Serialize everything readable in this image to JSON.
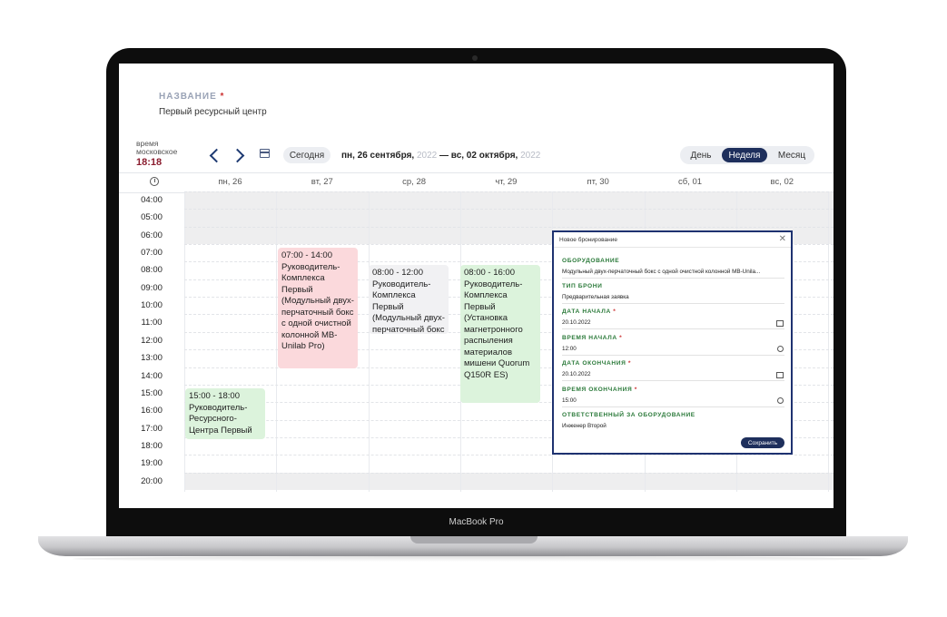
{
  "device": {
    "brand": "MacBook Pro"
  },
  "header": {
    "name_label": "НАЗВАНИЕ",
    "required_mark": "*",
    "name_value": "Первый ресурсный центр",
    "timezone_label": "время московское",
    "current_time": "18:18"
  },
  "toolbar": {
    "prev_icon": "chevron-left-icon",
    "next_icon": "chevron-right-icon",
    "calendar_icon": "calendar-icon",
    "today_label": "Сегодня",
    "range_start": "пн, 26 сентября",
    "range_start_year": "2022",
    "range_sep": "— вс, 02 октября",
    "range_end_year": "2022",
    "views": [
      "День",
      "Неделя",
      "Месяц"
    ],
    "active_view": "Неделя"
  },
  "days": [
    "пн, 26",
    "вт, 27",
    "ср, 28",
    "чт, 29",
    "пт, 30",
    "сб, 01",
    "вс, 02"
  ],
  "hours": [
    "04:00",
    "05:00",
    "06:00",
    "07:00",
    "08:00",
    "09:00",
    "10:00",
    "11:00",
    "12:00",
    "13:00",
    "14:00",
    "15:00",
    "16:00",
    "17:00",
    "18:00",
    "19:00",
    "20:00"
  ],
  "events": [
    {
      "day": "вт, 27",
      "time": "07:00 - 14:00",
      "title": "Руководитель-Комплекса Первый",
      "detail": "(Модульный двух-перчаточный бокс с одной очистной колонной MB-Unilab Pro)",
      "color": "#fbd9dc"
    },
    {
      "day": "ср, 28",
      "time": "08:00 - 12:00",
      "title": "Руководитель-Комплекса Первый",
      "detail": "(Модульный двух-перчаточный бокс",
      "color": "#f1f1f3"
    },
    {
      "day": "чт, 29",
      "time": "08:00 - 16:00",
      "title": "Руководитель-Комплекса Первый",
      "detail": "(Установка магнетронного распыления материалов мишени Quorum Q150R ES)",
      "color": "#dcf3dc"
    },
    {
      "day": "пн, 26",
      "time": "15:00 - 18:00",
      "title": "Руководитель-Ресурсного-Центра Первый",
      "detail": "",
      "color": "#dcf3dc"
    }
  ],
  "modal": {
    "title": "Новое бронирование",
    "close_icon": "close-icon",
    "fields": [
      {
        "label": "ОБОРУДОВАНИЕ",
        "required": false,
        "value": "Модульный двух-перчаточный бокс с одной очистной колонной MB-Unila..."
      },
      {
        "label": "ТИП БРОНИ",
        "required": false,
        "value": "Предварительная заявка"
      },
      {
        "label": "ДАТА НАЧАЛА",
        "required": true,
        "value": "20.10.2022",
        "icon": "calendar-icon"
      },
      {
        "label": "ВРЕМЯ НАЧАЛА",
        "required": true,
        "value": "12:00",
        "icon": "clock-icon"
      },
      {
        "label": "ДАТА ОКОНЧАНИЯ",
        "required": true,
        "value": "20.10.2022",
        "icon": "calendar-icon"
      },
      {
        "label": "ВРЕМЯ ОКОНЧАНИЯ",
        "required": true,
        "value": "15:00",
        "icon": "clock-icon"
      },
      {
        "label": "ОТВЕТСТВЕННЫЙ ЗА ОБОРУДОВАНИЕ",
        "required": false,
        "value": "Инженер Второй"
      }
    ],
    "save_label": "Сохранить"
  },
  "colors": {
    "accent": "#1e2f5c",
    "label_green": "#2b7a3a",
    "time_red": "#8a1c2e"
  }
}
